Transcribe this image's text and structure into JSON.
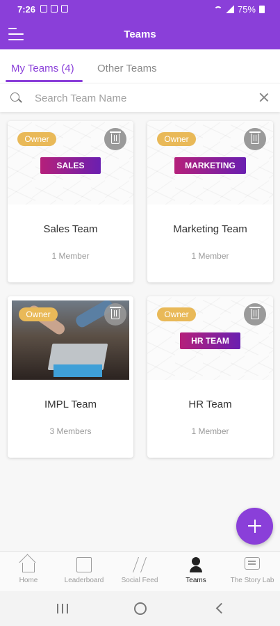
{
  "status_bar": {
    "time": "7:26",
    "battery": "75%"
  },
  "app_bar": {
    "title": "Teams"
  },
  "tabs": [
    {
      "label": "My Teams (4)",
      "active": true
    },
    {
      "label": "Other Teams",
      "active": false
    }
  ],
  "search": {
    "placeholder": "Search Team Name",
    "value": ""
  },
  "teams": [
    {
      "label": "SALES",
      "name": "Sales Team",
      "members": "1 Member",
      "owner_badge": "Owner"
    },
    {
      "label": "MARKETING",
      "name": "Marketing Team",
      "members": "1 Member",
      "owner_badge": "Owner"
    },
    {
      "label": "",
      "name": "IMPL Team",
      "members": "3 Members",
      "owner_badge": "Owner"
    },
    {
      "label": "HR TEAM",
      "name": "HR Team",
      "members": "1 Member",
      "owner_badge": "Owner"
    }
  ],
  "bottom_nav": [
    {
      "label": "Home",
      "icon": "home-icon"
    },
    {
      "label": "Leaderboard",
      "icon": "trophy-icon"
    },
    {
      "label": "Social Feed",
      "icon": "bolt-icon"
    },
    {
      "label": "Teams",
      "icon": "people-icon",
      "active": true
    },
    {
      "label": "The Story Lab",
      "icon": "chat-icon"
    }
  ],
  "colors": {
    "accent": "#8a3fd9",
    "owner_badge": "#e9b958"
  }
}
